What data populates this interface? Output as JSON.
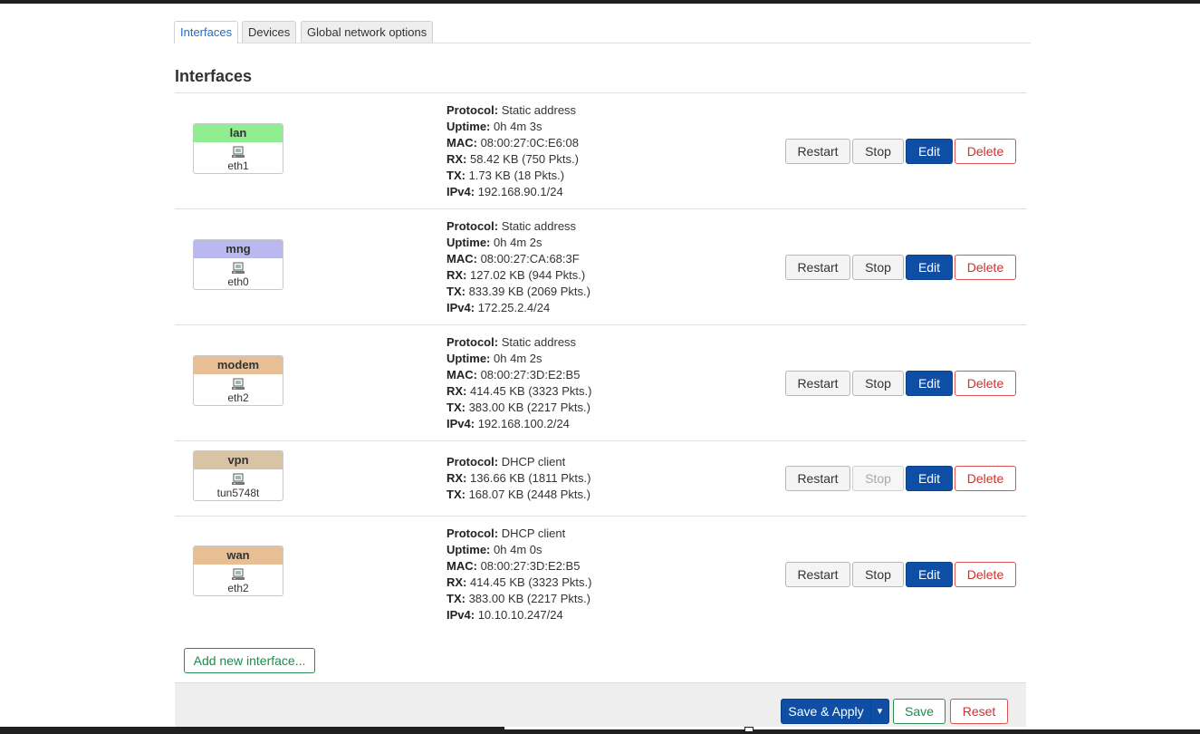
{
  "tabs": [
    {
      "label": "Interfaces",
      "active": true
    },
    {
      "label": "Devices",
      "active": false
    },
    {
      "label": "Global network options",
      "active": false
    }
  ],
  "section_title": "Interfaces",
  "interfaces": [
    {
      "name": "lan",
      "device": "eth1",
      "color": "#90ee90",
      "fields": [
        {
          "label": "Protocol:",
          "value": "Static address"
        },
        {
          "label": "Uptime:",
          "value": "0h 4m 3s"
        },
        {
          "label": "MAC:",
          "value": "08:00:27:0C:E6:08"
        },
        {
          "label": "RX:",
          "value": "58.42 KB (750 Pkts.)"
        },
        {
          "label": "TX:",
          "value": "1.73 KB (18 Pkts.)"
        },
        {
          "label": "IPv4:",
          "value": "192.168.90.1/24"
        }
      ]
    },
    {
      "name": "mng",
      "device": "eth0",
      "color": "#b9b8ef",
      "fields": [
        {
          "label": "Protocol:",
          "value": "Static address"
        },
        {
          "label": "Uptime:",
          "value": "0h 4m 2s"
        },
        {
          "label": "MAC:",
          "value": "08:00:27:CA:68:3F"
        },
        {
          "label": "RX:",
          "value": "127.02 KB (944 Pkts.)"
        },
        {
          "label": "TX:",
          "value": "833.39 KB (2069 Pkts.)"
        },
        {
          "label": "IPv4:",
          "value": "172.25.2.4/24"
        }
      ]
    },
    {
      "name": "modem",
      "device": "eth2",
      "color": "#e8bf95",
      "fields": [
        {
          "label": "Protocol:",
          "value": "Static address"
        },
        {
          "label": "Uptime:",
          "value": "0h 4m 2s"
        },
        {
          "label": "MAC:",
          "value": "08:00:27:3D:E2:B5"
        },
        {
          "label": "RX:",
          "value": "414.45 KB (3323 Pkts.)"
        },
        {
          "label": "TX:",
          "value": "383.00 KB (2217 Pkts.)"
        },
        {
          "label": "IPv4:",
          "value": "192.168.100.2/24"
        }
      ]
    },
    {
      "name": "vpn",
      "device": "tun5748t",
      "color": "#d8c3a4",
      "fields": [
        {
          "label": "Protocol:",
          "value": "DHCP client"
        },
        {
          "label": "RX:",
          "value": "136.66 KB (1811 Pkts.)"
        },
        {
          "label": "TX:",
          "value": "168.07 KB (2448 Pkts.)"
        }
      ]
    },
    {
      "name": "wan",
      "device": "eth2",
      "color": "#e8bf95",
      "fields": [
        {
          "label": "Protocol:",
          "value": "DHCP client"
        },
        {
          "label": "Uptime:",
          "value": "0h 4m 0s"
        },
        {
          "label": "MAC:",
          "value": "08:00:27:3D:E2:B5"
        },
        {
          "label": "RX:",
          "value": "414.45 KB (3323 Pkts.)"
        },
        {
          "label": "TX:",
          "value": "383.00 KB (2217 Pkts.)"
        },
        {
          "label": "IPv4:",
          "value": "10.10.10.247/24"
        }
      ]
    }
  ],
  "row_buttons": {
    "restart": "Restart",
    "stop": "Stop",
    "edit": "Edit",
    "delete": "Delete"
  },
  "add_interface_label": "Add new interface...",
  "footer": {
    "save_apply": "Save & Apply",
    "dropdown": "▾",
    "save": "Save",
    "reset": "Reset"
  }
}
